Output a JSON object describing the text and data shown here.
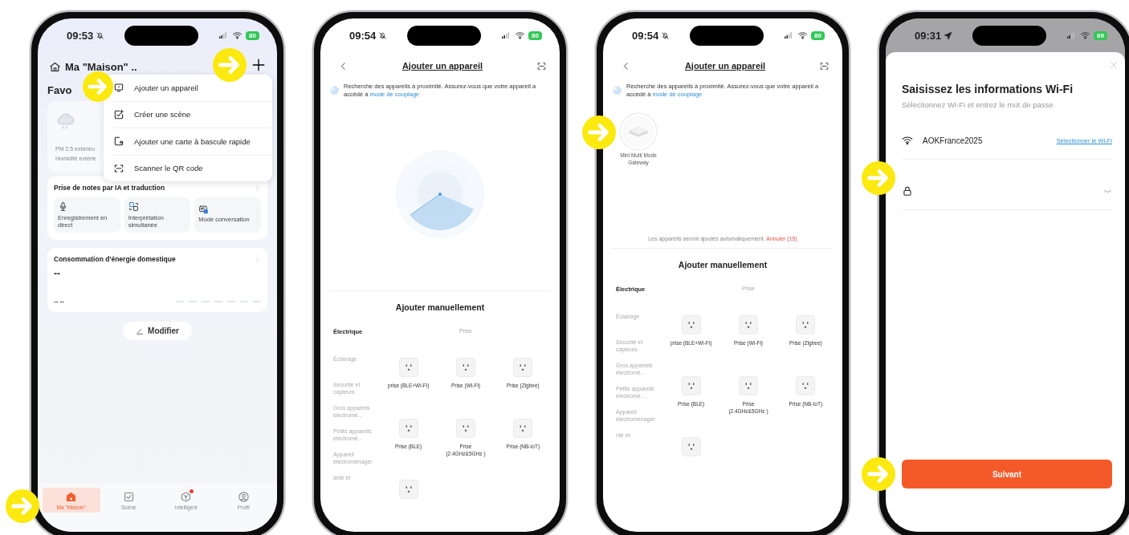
{
  "phones": [
    {
      "kind": "home",
      "status": {
        "time": "09:53",
        "kind": "silent",
        "battery": "80"
      },
      "header": {
        "title": "Ma \"Maison\" ..",
        "add_pointed": true
      },
      "section_title": "Favo",
      "weather": {
        "lines": [
          "PM 2.5 extérieu",
          "Humidité extérie"
        ]
      },
      "menu": [
        {
          "label": "Ajouter un appareil",
          "kind": "device",
          "pointed": true
        },
        {
          "label": "Créer une scène",
          "kind": "scene",
          "pointed": false
        },
        {
          "label": "Ajouter une carte à bascule rapide",
          "kind": "card",
          "pointed": false
        },
        {
          "label": "Scanner le QR code",
          "kind": "scan",
          "pointed": false
        }
      ],
      "ai_card": {
        "title": "Prise de notes par IA et traduction",
        "tiles": [
          {
            "label": "Enregistrement en direct",
            "kind": "mic"
          },
          {
            "label": "Interprétation simultanée",
            "kind": "translate"
          },
          {
            "label": "Mode conversation",
            "kind": "chat"
          }
        ]
      },
      "energy_card": {
        "title": "Consommation d'énergie domestique",
        "value": "--",
        "period": "-- --"
      },
      "edit_button": "Modifier",
      "tabs": [
        {
          "label": "Ma \"Maison\"",
          "kind": "home",
          "selected": true,
          "badge": false,
          "pointed": true
        },
        {
          "label": "Scène",
          "kind": "scene",
          "selected": false,
          "badge": false,
          "pointed": false
        },
        {
          "label": "Intelligent",
          "kind": "smart",
          "selected": false,
          "badge": true,
          "pointed": false
        },
        {
          "label": "Profil",
          "kind": "profile",
          "selected": false,
          "badge": false,
          "pointed": false
        }
      ]
    },
    {
      "kind": "search",
      "status": {
        "time": "09:54",
        "kind": "silent",
        "battery": "80"
      },
      "title": "Ajouter un appareil",
      "notice": {
        "text": "Recherche des appareils à proximité. Assurez-vous que votre appareil a accédé à",
        "link": "mode de couplage"
      },
      "manual": {
        "title": "Ajouter manuellement",
        "group_title": "Prise",
        "categories": [
          {
            "label": "Électrique",
            "selected": true
          },
          {
            "label": "Éclairage",
            "selected": false
          },
          {
            "label": "Sécurité et capteurs",
            "selected": false
          },
          {
            "label": "Gros appareils électromé...",
            "selected": false
          },
          {
            "label": "Petits appareils électromé...",
            "selected": false
          },
          {
            "label": "Appareil électroménager",
            "selected": false
          },
          {
            "label": "anté et",
            "selected": false
          }
        ],
        "products": [
          {
            "kind": "socket",
            "label": "prise (BLE+Wi-Fi)"
          },
          {
            "kind": "socket",
            "label": "Prise (Wi-Fi)"
          },
          {
            "kind": "socket",
            "label": "Prise (Zigbee)"
          },
          {
            "kind": "socket",
            "label": "Prise (BLE)"
          },
          {
            "kind": "socket",
            "label": "Prise (2.4GHz&5GHz )"
          },
          {
            "kind": "socket",
            "label": "Prise (NB-IoT)"
          },
          {
            "kind": "socket"
          }
        ]
      }
    },
    {
      "kind": "found",
      "status": {
        "time": "09:54",
        "kind": "silent",
        "battery": "80"
      },
      "title": "Ajouter un appareil",
      "notice": {
        "text": "Recherche des appareils à proximité. Assurez-vous que votre appareil a accédé à",
        "link": "mode de couplage"
      },
      "device": {
        "name": "Mini Multi Mode Gateway",
        "pointed": true
      },
      "auto_note": {
        "text": "Les appareils seront ajoutés automatiquement.",
        "action": "Annuler (15)"
      },
      "manual": {
        "title": "Ajouter manuellement",
        "group_title": "Prise",
        "categories": [
          {
            "label": "Électrique",
            "selected": true
          },
          {
            "label": "Éclairage",
            "selected": false
          },
          {
            "label": "Sécurité et capteurs",
            "selected": false
          },
          {
            "label": "Gros appareils électromé...",
            "selected": false
          },
          {
            "label": "Petits appareils électromé...",
            "selected": false
          },
          {
            "label": "Appareil électroménager",
            "selected": false
          },
          {
            "label": "nté et",
            "selected": false
          }
        ],
        "products": [
          {
            "kind": "socket",
            "label": "prise (BLE+Wi-Fi)"
          },
          {
            "kind": "socket",
            "label": "Prise (Wi-Fi)"
          },
          {
            "kind": "socket",
            "label": "Prise (Zigbee)"
          },
          {
            "kind": "socket",
            "label": "Prise (BLE)"
          },
          {
            "kind": "socket",
            "label": "Prise (2.4GHz&5GHz )"
          },
          {
            "kind": "socket",
            "label": "Prise (NB-IoT)"
          },
          {
            "kind": "socket"
          }
        ]
      }
    },
    {
      "kind": "wifi",
      "status": {
        "time": "09:31",
        "kind": "location",
        "battery": "69"
      },
      "title": "Saisissez les informations Wi-Fi",
      "subtitle": "Sélectionnez Wi-Fi et entrez le mot de passe",
      "network": {
        "name": "AOKFrance2025",
        "link": "Sélectionner le Wi-Fi"
      },
      "password": {
        "pointed": true
      },
      "next_button": {
        "label": "Suivant",
        "pointed": true
      }
    }
  ]
}
